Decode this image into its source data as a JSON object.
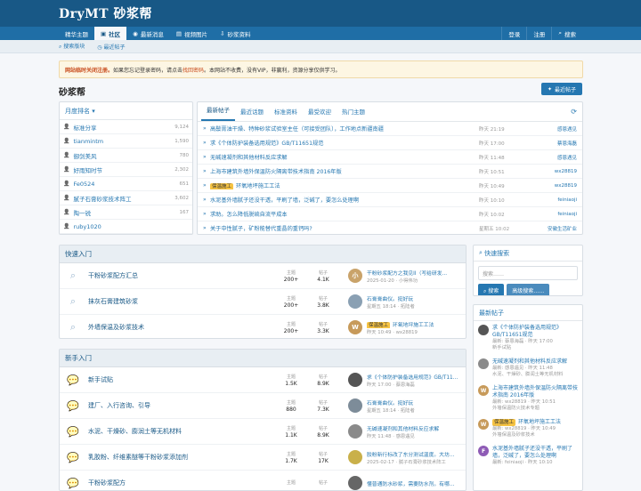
{
  "header": {
    "logo": "DryMT 砂浆帮"
  },
  "nav": {
    "items": [
      "精华主题",
      "社区",
      "最新消息",
      "视频图片",
      "砂浆资料"
    ],
    "right": [
      "登录",
      "注册",
      "搜索"
    ]
  },
  "subnav": {
    "items": [
      "搜索版块",
      "最近帖子"
    ]
  },
  "notice": {
    "bold": "网站临时关闭注册。",
    "text": "如果您忘记登录密码，请点击",
    "link": "找回密码",
    "rest": "。本网站不收费，没有VIP，非赢利，资源分享仅供学习。"
  },
  "page": {
    "title": "砂浆帮",
    "new_post": "最近帖子"
  },
  "ranking": {
    "title": "月度排名",
    "users": [
      {
        "name": "标准分享",
        "score": "9,124"
      },
      {
        "name": "tianmintm",
        "score": "1,590"
      },
      {
        "name": "御剑美风",
        "score": "780"
      },
      {
        "name": "好雨知时节",
        "score": "2,302"
      },
      {
        "name": "Fe0524",
        "score": "651"
      },
      {
        "name": "腻子石膏砂浆技术阵工",
        "score": "3,602"
      },
      {
        "name": "陶一锐",
        "score": "167"
      },
      {
        "name": "ruby1020",
        "score": ""
      }
    ]
  },
  "latest": {
    "tabs": [
      "最新帖子",
      "最近话题",
      "标准资料",
      "最受欢迎",
      "热门主题"
    ],
    "rows": [
      {
        "tag": "",
        "title": "高鬃膏油干燥、特种砂浆试验室主任（可接受团队），工作地点新疆南疆",
        "time": "昨天 21:19",
        "user": "感恩遇见"
      },
      {
        "tag": "",
        "title": "求《个体防护装备选用规范》GB/T11651规范",
        "time": "昨天 17:00",
        "user": "蔡恩海磊"
      },
      {
        "tag": "",
        "title": "无碱速凝剂和其他材料反应求解",
        "time": "昨天 11:48",
        "user": "感恩遇见"
      },
      {
        "tag": "",
        "title": "上海市建筑外墙外保温防火隔离带技术指南 2016年版",
        "time": "昨天 10:51",
        "user": "wx28819"
      },
      {
        "tag": "保温施工",
        "title": "环氧地坪施工工法",
        "time": "昨天 10:49",
        "user": "wx28819"
      },
      {
        "tag": "",
        "title": "水泥基外墙腻子还没干透，平刷了墙，泛碱了，要怎么处理啊",
        "time": "昨天 10:10",
        "user": "feiniaoji"
      },
      {
        "tag": "",
        "title": "求助。怎么降低脱硫自流平成本",
        "time": "昨天 10:02",
        "user": "feiniaoji"
      },
      {
        "tag": "",
        "title": "关于中性腻子，矿粉能替代重晶的重钙吗?",
        "time": "星期五 10:02",
        "user": "安徽生活矿业"
      }
    ]
  },
  "quick": {
    "title": "快速入门",
    "nodes": [
      {
        "name": "干粉砂浆配方汇总",
        "threads": "200+",
        "posts": "4.1K",
        "av": "小",
        "avc": "#c9a36a",
        "last": "干粉砂浆配方之我见II（写给研发...",
        "meta": "2025-01-20 · 小得伟功"
      },
      {
        "name": "抹灰石膏建筑砂浆",
        "threads": "200+",
        "posts": "3.8K",
        "av": "",
        "avc": "#8aa0b3",
        "last": "石膏膏曲仪。挺好玩",
        "meta": "星期五 18:14 · 拓陆者"
      },
      {
        "name": "外墙保温及砂浆技术",
        "threads": "200+",
        "posts": "3.3K",
        "av": "W",
        "avc": "#c79a5a",
        "last": "环氧地坪施工工法",
        "tag": "保温施工",
        "meta": "昨天 10:49 · wx28819"
      }
    ]
  },
  "newbie": {
    "title": "新手入门",
    "nodes": [
      {
        "name": "新手试贴",
        "threads": "1.5K",
        "posts": "8.9K",
        "av": "",
        "avc": "#555",
        "last": "求《个体防护装备选用规范》GB/T11...",
        "meta": "昨天 17:00 · 蔡恩海磊"
      },
      {
        "name": "建厂、入行咨询、引导",
        "threads": "880",
        "posts": "7.3K",
        "av": "",
        "avc": "#7d8c99",
        "last": "石膏膏曲仪。挺好玩",
        "meta": "星期五 18:14 · 拓陆者"
      },
      {
        "name": "水泥、干燥砂、膨润土等无机材料",
        "threads": "1.1K",
        "posts": "8.9K",
        "av": "",
        "avc": "#8a8a8a",
        "last": "无碱速凝剂和其他材料反应求解",
        "meta": "昨天 11:48 · 感恩遇见"
      },
      {
        "name": "乳胶粉、纤维素醚等干粉砂浆添加剂",
        "threads": "1.7K",
        "posts": "17K",
        "av": "",
        "avc": "#c9b04a",
        "last": "胶粉新行标改了东分测试温度。大坊...",
        "meta": "2025-02-17 · 腻子石膏砂浆技术阵工"
      },
      {
        "name": "干粉砂浆配方",
        "threads": "",
        "posts": "",
        "av": "",
        "avc": "#666",
        "last": "懂普通防水砂浆，需要防水剂。有哪...",
        "meta": ""
      }
    ]
  },
  "labels": {
    "threads": "主题",
    "posts": "帖子"
  },
  "sidebar": {
    "search_title": "快速搜索",
    "search_placeholder": "搜索……",
    "search_btn": "搜索",
    "adv_btn": "高级搜索……",
    "latest_title": "最新帖子",
    "posts": [
      {
        "av": "",
        "avc": "#555",
        "title": "求《个体防护装备选用规范》GB/T11651规范",
        "meta": "最新: 蔡恩海磊 · 昨天 17:00",
        "forum": "新手试贴"
      },
      {
        "av": "",
        "avc": "#8a8a8a",
        "title": "无碱速凝剂和其他材料反应求解",
        "meta": "最新: 感恩遇见 · 昨天 11:48",
        "forum": "水泥、干燥砂、膨润土等无机材料"
      },
      {
        "av": "W",
        "avc": "#c79a5a",
        "title": "上海市建筑外墙外保温防火隔离带技术指南 2016年版",
        "meta": "最新: wx28819 · 昨天 10:51",
        "forum": "外墙保温防火技术专题"
      },
      {
        "av": "W",
        "avc": "#c79a5a",
        "tag": "保温施工",
        "title": "环氧地坪施工工法",
        "meta": "最新: wx28819 · 昨天 10:49",
        "forum": "外墙保温及砂浆技术"
      },
      {
        "av": "F",
        "avc": "#8e5bb5",
        "title": "水泥基外墙腻子还没干透，平刷了墙，泛碱了，要怎么处理啊",
        "meta": "最新: feiniaoji · 昨天 10:10",
        "forum": ""
      }
    ]
  }
}
